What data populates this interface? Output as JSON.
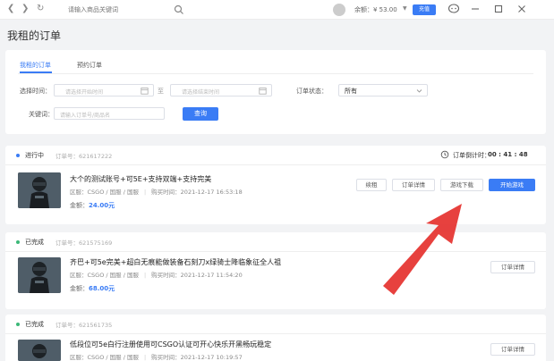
{
  "topbar": {
    "search_placeholder": "请输入商品关键词",
    "balance": "余额：¥ 53.00",
    "recharge": "充值"
  },
  "page_title": "我租的订单",
  "tabs": [
    "我租的订单",
    "预约订单"
  ],
  "filters": {
    "time_label": "选择时间：",
    "start_placeholder": "请选择开始时间",
    "sep": "至",
    "end_placeholder": "请选择结束时间",
    "status_label": "订单状态：",
    "status_value": "所有",
    "keyword_label": "关键词：",
    "keyword_placeholder": "请输入订单号/商品名",
    "search_button": "查询"
  },
  "orders": [
    {
      "status": "进行中",
      "status_color": "#3a7cf5",
      "order_id": "订单号：621617222",
      "timer_label": "订单倒计时：",
      "timer_value": "00 : 41 : 48",
      "title": "大个的测试账号+可5E+支持双端+支持完美",
      "region": "区服：CSGO / 国服 / 国服",
      "time": "购买时间：2021-12-17 16:53:18",
      "amount_label": "金额：",
      "amount": "24.00元",
      "buttons": [
        "续租",
        "订单详情",
        "游戏下载",
        "开始游戏"
      ]
    },
    {
      "status": "已完成",
      "status_color": "#3cb878",
      "order_id": "订单号：621575169",
      "title": "齐巴+可5e完美+超白无痕能做装备石刻刀x绿骑士降临象征全人祖",
      "region": "区服：CSGO / 国服 / 国服",
      "time": "购买时间：2021-12-17 11:54:20",
      "amount_label": "金额：",
      "amount": "68.00元",
      "buttons": [
        "订单详情"
      ]
    },
    {
      "status": "已完成",
      "status_color": "#3cb878",
      "order_id": "订单号：621561735",
      "title": "低段位可5e白行注册使用可CSGO认证可开心快乐开黑畅玩稳定",
      "region": "区服：CSGO / 国服 / 国服",
      "time": "购买时间：2021-12-17 10:19:57",
      "buttons": [
        "订单详情"
      ]
    }
  ]
}
